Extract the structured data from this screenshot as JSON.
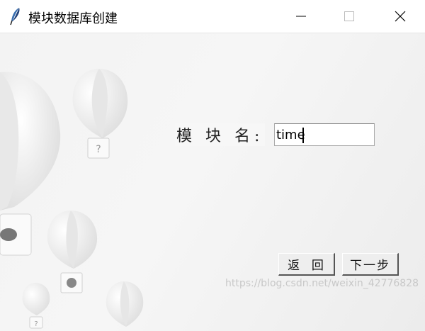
{
  "window": {
    "title": "模块数据库创建",
    "icon": "feather-icon"
  },
  "form": {
    "module_name_label": "模 块 名:",
    "module_name_value": "time"
  },
  "buttons": {
    "back_label": "返  回",
    "next_label": "下一步"
  },
  "watermark": "https://blog.csdn.net/weixin_42776828"
}
